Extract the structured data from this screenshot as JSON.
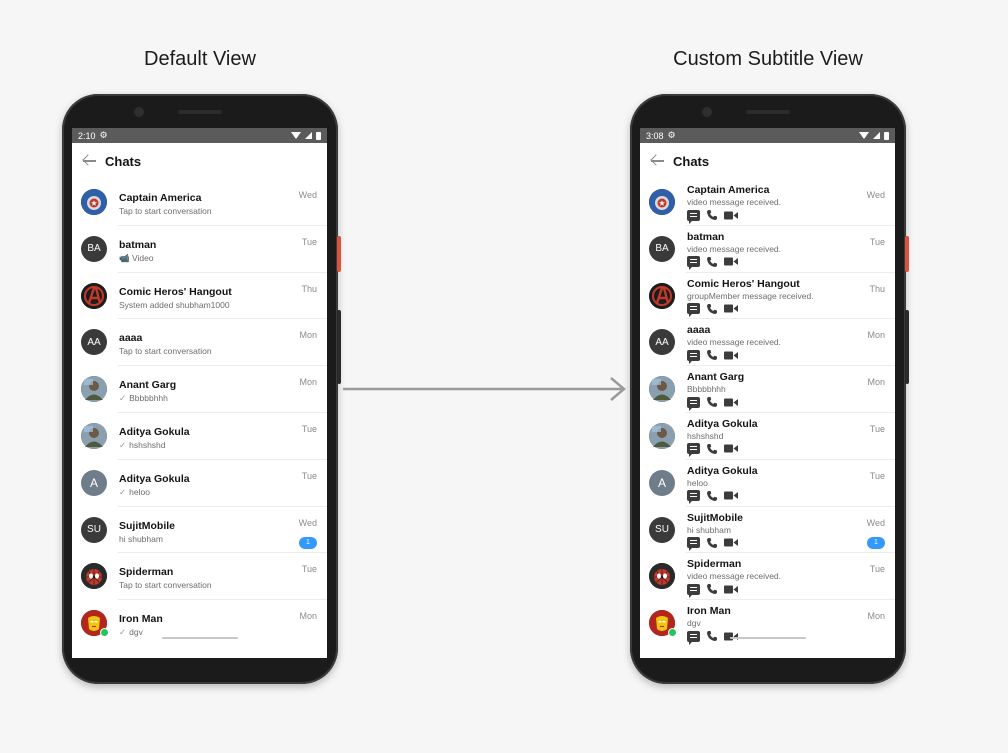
{
  "titles": {
    "left": "Default View",
    "right": "Custom Subtitle View"
  },
  "left_phone": {
    "status_time": "2:10",
    "header": "Chats"
  },
  "right_phone": {
    "status_time": "3:08",
    "header": "Chats"
  },
  "colors": {
    "badge": "#3399ff",
    "online": "#22c55e",
    "arrow": "#9a9a9a"
  },
  "chats": [
    {
      "name": "Captain America",
      "avatar": "",
      "avatar_icon": "captain-america-avatar",
      "date": "Wed",
      "subtitle": "Tap to start conversation",
      "custom_subtitle": "video message received.",
      "badge": "",
      "tick": false
    },
    {
      "name": "batman",
      "avatar": "BA",
      "date": "Tue",
      "subtitle": "📹 Video",
      "custom_subtitle": "video message received.",
      "badge": "",
      "tick": false
    },
    {
      "name": "Comic Heros' Hangout",
      "avatar": "",
      "avatar_icon": "avengers-avatar",
      "date": "Thu",
      "subtitle": "System added shubham1000",
      "custom_subtitle": "groupMember message received.",
      "badge": "",
      "tick": false
    },
    {
      "name": "aaaa",
      "avatar": "AA",
      "date": "Mon",
      "subtitle": "Tap to start conversation",
      "custom_subtitle": "video message received.",
      "badge": "",
      "tick": false
    },
    {
      "name": "Anant Garg",
      "avatar": "",
      "avatar_icon": "photo-avatar",
      "date": "Mon",
      "subtitle": "Bbbbbhhh",
      "custom_subtitle": "Bbbbbhhh",
      "badge": "",
      "tick": true
    },
    {
      "name": "Aditya Gokula",
      "avatar": "",
      "avatar_icon": "photo-avatar",
      "date": "Tue",
      "subtitle": "hshshshd",
      "custom_subtitle": "hshshshd",
      "badge": "",
      "tick": true
    },
    {
      "name": "Aditya Gokula",
      "avatar": "A",
      "date": "Tue",
      "subtitle": "heloo",
      "custom_subtitle": "heloo",
      "badge": "",
      "tick": true
    },
    {
      "name": "SujitMobile",
      "avatar": "SU",
      "date": "Wed",
      "subtitle": "hi shubham",
      "custom_subtitle": "hi shubham",
      "badge": "1",
      "tick": false
    },
    {
      "name": "Spiderman",
      "avatar": "",
      "avatar_icon": "spiderman-avatar",
      "date": "Tue",
      "subtitle": "Tap to start conversation",
      "custom_subtitle": "video message received.",
      "badge": "",
      "tick": false
    },
    {
      "name": "Iron Man",
      "avatar": "",
      "avatar_icon": "ironman-avatar",
      "date": "Mon",
      "subtitle": "dgv",
      "custom_subtitle": "dgv",
      "badge": "",
      "tick": true,
      "online": true
    }
  ],
  "action_icons": [
    "message-icon",
    "call-icon",
    "video-call-icon"
  ]
}
